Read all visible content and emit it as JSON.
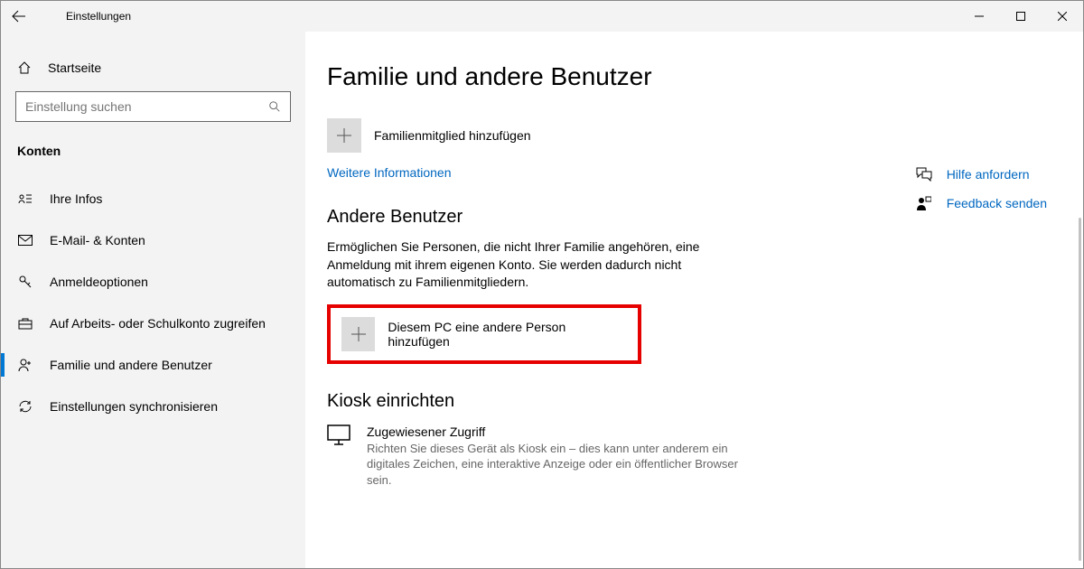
{
  "window": {
    "title": "Einstellungen"
  },
  "sidebar": {
    "home": "Startseite",
    "search_placeholder": "Einstellung suchen",
    "section": "Konten",
    "items": [
      {
        "label": "Ihre Infos"
      },
      {
        "label": "E-Mail- & Konten"
      },
      {
        "label": "Anmeldeoptionen"
      },
      {
        "label": "Auf Arbeits- oder Schulkonto zugreifen"
      },
      {
        "label": "Familie und andere Benutzer"
      },
      {
        "label": "Einstellungen synchronisieren"
      }
    ]
  },
  "main": {
    "title": "Familie und andere Benutzer",
    "add_family": "Familienmitglied hinzufügen",
    "more_info": "Weitere Informationen",
    "other_users_heading": "Andere Benutzer",
    "other_users_body": "Ermöglichen Sie Personen, die nicht Ihrer Familie angehören, eine Anmeldung mit ihrem eigenen Konto. Sie werden dadurch nicht automatisch zu Familienmitgliedern.",
    "add_other": "Diesem PC eine andere Person hinzufügen",
    "kiosk_heading": "Kiosk einrichten",
    "kiosk_title": "Zugewiesener Zugriff",
    "kiosk_body": "Richten Sie dieses Gerät als Kiosk ein – dies kann unter anderem ein digitales Zeichen, eine interaktive Anzeige oder ein öffentlicher Browser sein."
  },
  "right": {
    "help": "Hilfe anfordern",
    "feedback": "Feedback senden"
  }
}
